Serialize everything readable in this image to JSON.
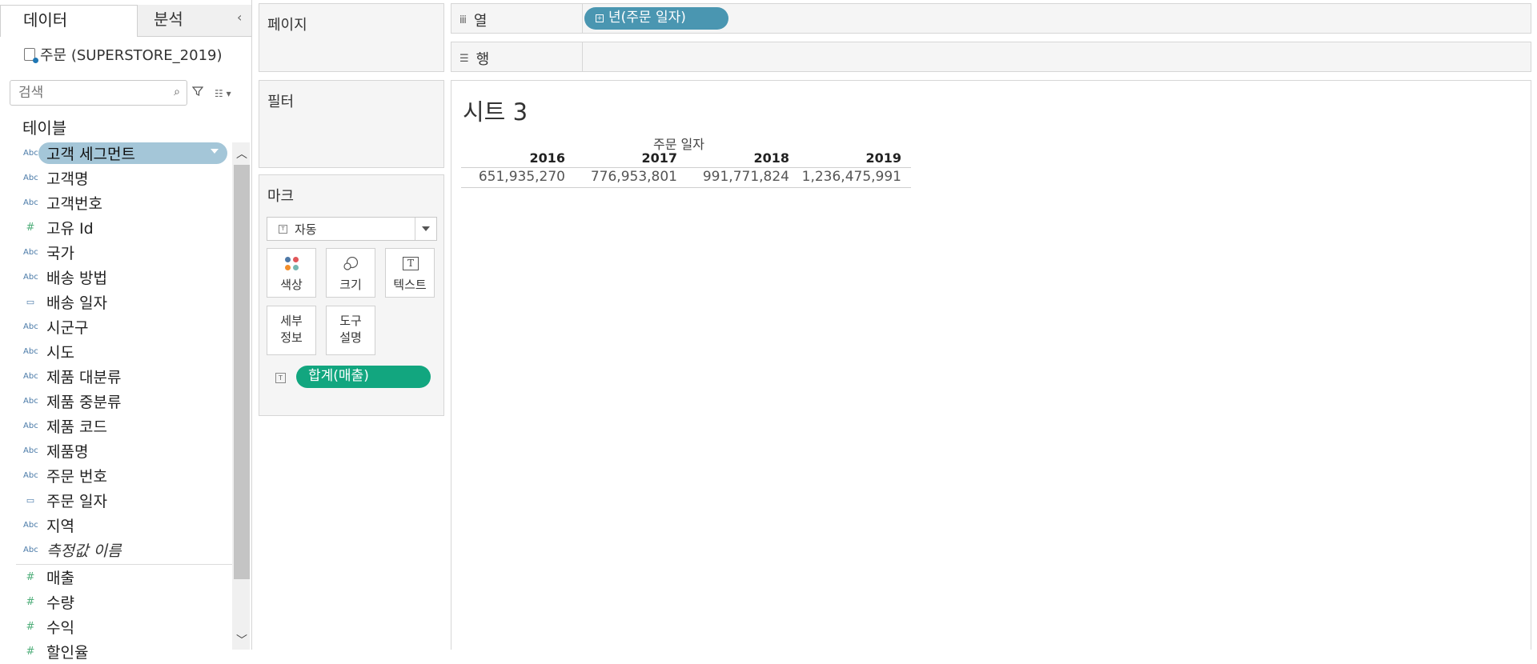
{
  "tabs": {
    "data": "데이터",
    "analysis": "분석",
    "collapse": "‹"
  },
  "datasource": "주문 (SUPERSTORE_2019)",
  "search": {
    "placeholder": "검색"
  },
  "tables_title": "테이블",
  "fields": [
    {
      "name": "고객 세그먼트",
      "type": "Abc",
      "selected": true
    },
    {
      "name": "고객명",
      "type": "Abc"
    },
    {
      "name": "고객번호",
      "type": "Abc"
    },
    {
      "name": "고유 Id",
      "type": "#"
    },
    {
      "name": "국가",
      "type": "Abc"
    },
    {
      "name": "배송 방법",
      "type": "Abc"
    },
    {
      "name": "배송 일자",
      "type": "calendar"
    },
    {
      "name": "시군구",
      "type": "Abc"
    },
    {
      "name": "시도",
      "type": "Abc"
    },
    {
      "name": "제품 대분류",
      "type": "Abc"
    },
    {
      "name": "제품 중분류",
      "type": "Abc"
    },
    {
      "name": "제품 코드",
      "type": "Abc"
    },
    {
      "name": "제품명",
      "type": "Abc"
    },
    {
      "name": "주문 번호",
      "type": "Abc"
    },
    {
      "name": "주문 일자",
      "type": "calendar"
    },
    {
      "name": "지역",
      "type": "Abc"
    },
    {
      "name": "측정값 이름",
      "type": "Abc",
      "italic": true
    },
    {
      "name": "매출",
      "type": "#"
    },
    {
      "name": "수량",
      "type": "#"
    },
    {
      "name": "수익",
      "type": "#"
    },
    {
      "name": "할인율",
      "type": "#"
    }
  ],
  "shelves": {
    "pages": "페이지",
    "filters": "필터",
    "marks": "마크",
    "columns_label": "열",
    "rows_label": "행",
    "column_pill": "년(주문 일자)"
  },
  "marks": {
    "type": "자동",
    "color": "색상",
    "size": "크기",
    "text": "텍스트",
    "detail": [
      "세부",
      "정보"
    ],
    "tooltip": [
      "도구",
      "설명"
    ],
    "pill": "합계(매출)",
    "dot_colors": [
      "#4e79a7",
      "#e15759",
      "#f28e2b",
      "#76b7b2"
    ]
  },
  "sheet": {
    "title": "시트 3",
    "column_header": "주문 일자",
    "years": [
      "2016",
      "2017",
      "2018",
      "2019"
    ],
    "values": [
      "651,935,270",
      "776,953,801",
      "991,771,824",
      "1,236,475,991"
    ]
  }
}
